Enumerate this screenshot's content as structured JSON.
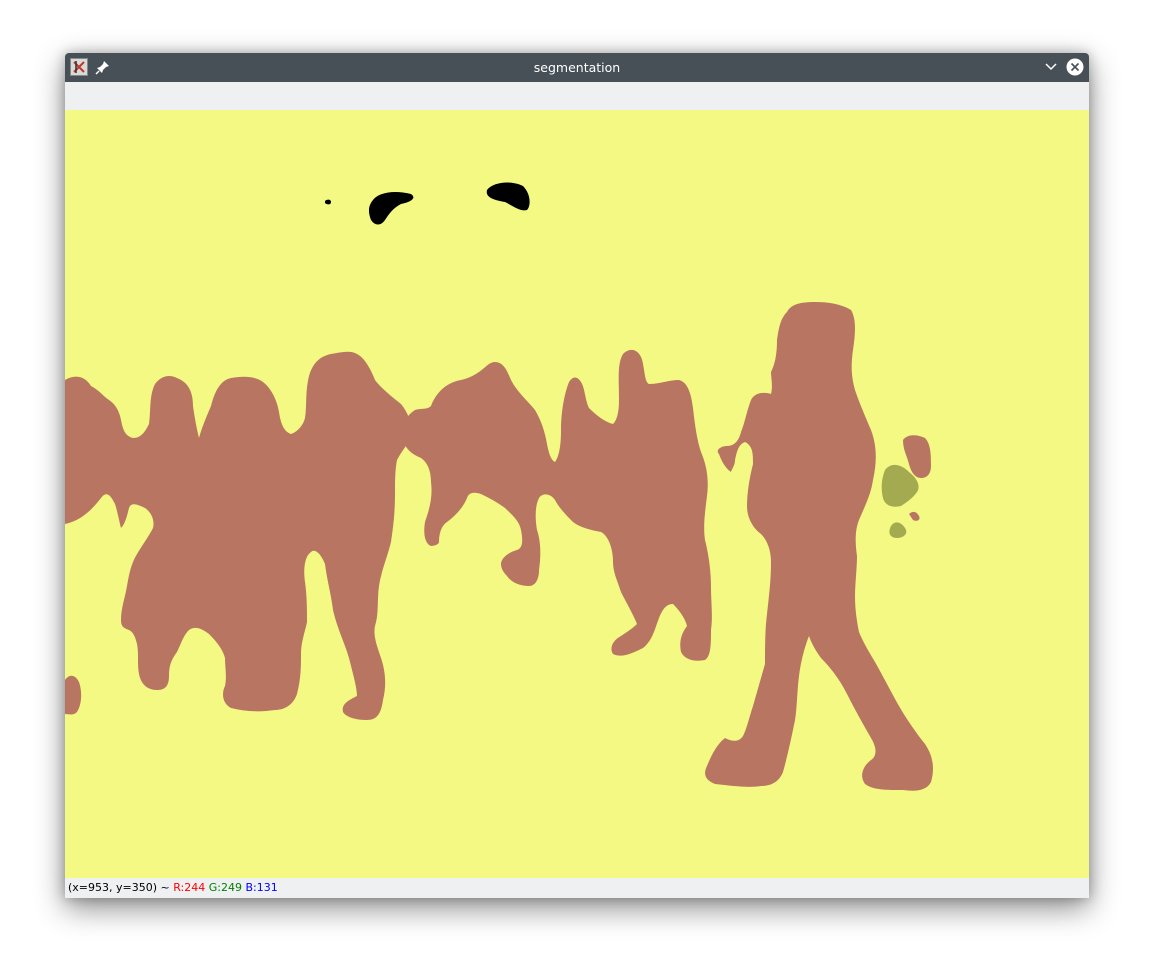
{
  "window": {
    "title": "segmentation"
  },
  "icons": {
    "app": "app-icon",
    "pin": "pin-icon",
    "minimize": "chevron-down-icon",
    "close": "close-icon"
  },
  "colors": {
    "background_class": "#f4f983",
    "person_class": "#b87662",
    "plant_class": "#a3aa50",
    "dark_class": "#000000"
  },
  "status": {
    "coords": "(x=953, y=350) ~",
    "r": "R:244",
    "g": "G:249",
    "b": "B:131"
  }
}
